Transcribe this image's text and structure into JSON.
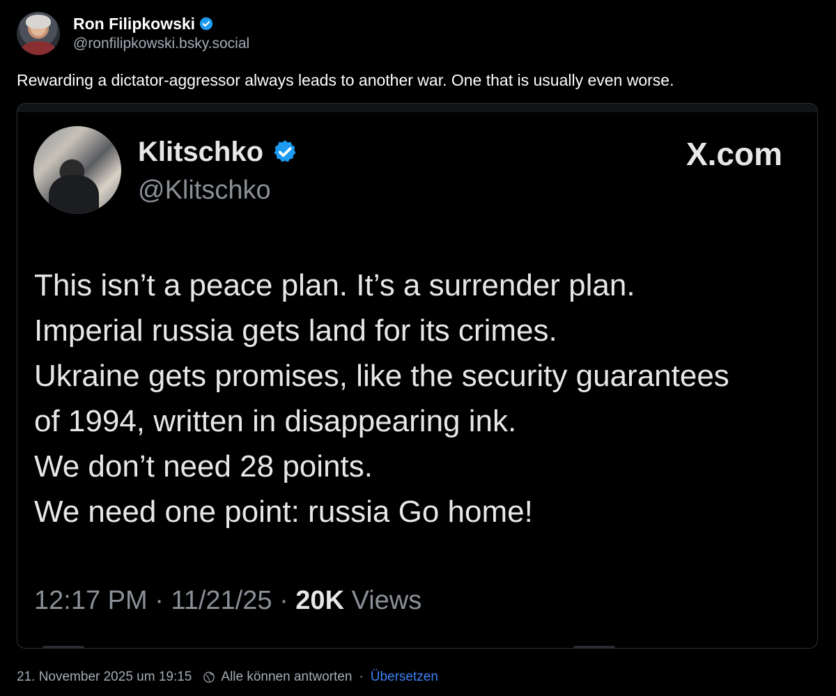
{
  "post": {
    "author_name": "Ron Filipkowski",
    "author_handle": "@ronfilipkowski.bsky.social",
    "text": "Rewarding a dictator-aggressor always leads to another war. One that is usually even worse.",
    "timestamp": "21. November 2025 um 19:15",
    "reply_setting": "Alle können antworten",
    "separator": "·",
    "translate_label": "Übersetzen"
  },
  "embed": {
    "author_name": "Klitschko",
    "author_handle": "@Klitschko",
    "source": "X.com",
    "lines": [
      "This isn’t a peace plan. It’s a surrender plan.",
      "Imperial russia gets land for its crimes.",
      "Ukraine gets promises, like the security guarantees",
      "of 1994, written in disappearing ink.",
      "We don’t need 28 points.",
      "We need one point: russia Go home!"
    ],
    "meta_time": "12:17 PM · 11/21/25 · ",
    "meta_views_count": "20K",
    "meta_views_label": " Views"
  },
  "icons": {
    "verified_badge": "verified-check-icon",
    "reply_setting": "globe-icon"
  },
  "colors": {
    "background": "#000000",
    "text": "#ffffff",
    "muted": "#a4acb6",
    "link": "#3b82f6",
    "verified": "#1d9bf0"
  }
}
